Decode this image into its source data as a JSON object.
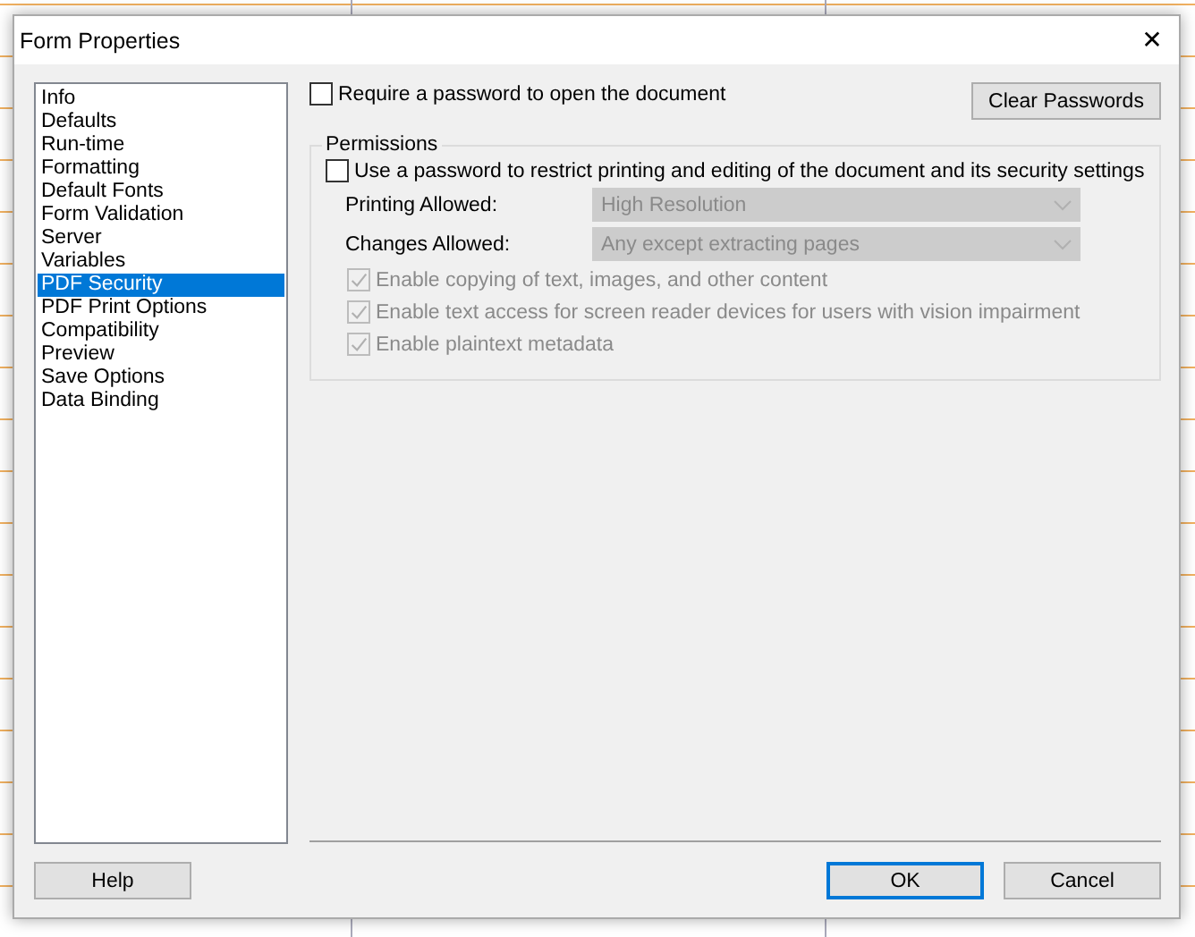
{
  "window": {
    "title": "Form Properties",
    "close": "✕"
  },
  "sidebar": {
    "items": [
      {
        "label": "Info",
        "selected": false
      },
      {
        "label": "Defaults",
        "selected": false
      },
      {
        "label": "Run-time",
        "selected": false
      },
      {
        "label": "Formatting",
        "selected": false
      },
      {
        "label": "Default Fonts",
        "selected": false
      },
      {
        "label": "Form Validation",
        "selected": false
      },
      {
        "label": "Server",
        "selected": false
      },
      {
        "label": "Variables",
        "selected": false
      },
      {
        "label": "PDF Security",
        "selected": true
      },
      {
        "label": "PDF Print Options",
        "selected": false
      },
      {
        "label": "Compatibility",
        "selected": false
      },
      {
        "label": "Preview",
        "selected": false
      },
      {
        "label": "Save Options",
        "selected": false
      },
      {
        "label": "Data Binding",
        "selected": false
      }
    ]
  },
  "open_password": {
    "label": "Require a password to open the document",
    "checked": false,
    "disabled": false
  },
  "clear_button": "Clear Passwords",
  "permissions": {
    "title": "Permissions",
    "restrict": {
      "label": "Use a password to restrict printing and editing of the document and its security settings",
      "checked": false,
      "disabled": false
    },
    "selects": [
      {
        "label": "Printing Allowed:",
        "value": "High Resolution",
        "disabled": true
      },
      {
        "label": "Changes Allowed:",
        "value": "Any except extracting pages",
        "disabled": true
      }
    ],
    "options": [
      {
        "label": "Enable copying of text, images, and other content",
        "checked": true,
        "disabled": true
      },
      {
        "label": "Enable text access for screen reader devices for users with vision impairment",
        "checked": true,
        "disabled": true
      },
      {
        "label": "Enable plaintext metadata",
        "checked": true,
        "disabled": true
      }
    ]
  },
  "buttons": [
    {
      "label": "Help",
      "kind": "left",
      "default": false
    },
    {
      "label": "OK",
      "kind": "right",
      "default": true
    },
    {
      "label": "Cancel",
      "kind": "right",
      "default": false
    }
  ]
}
